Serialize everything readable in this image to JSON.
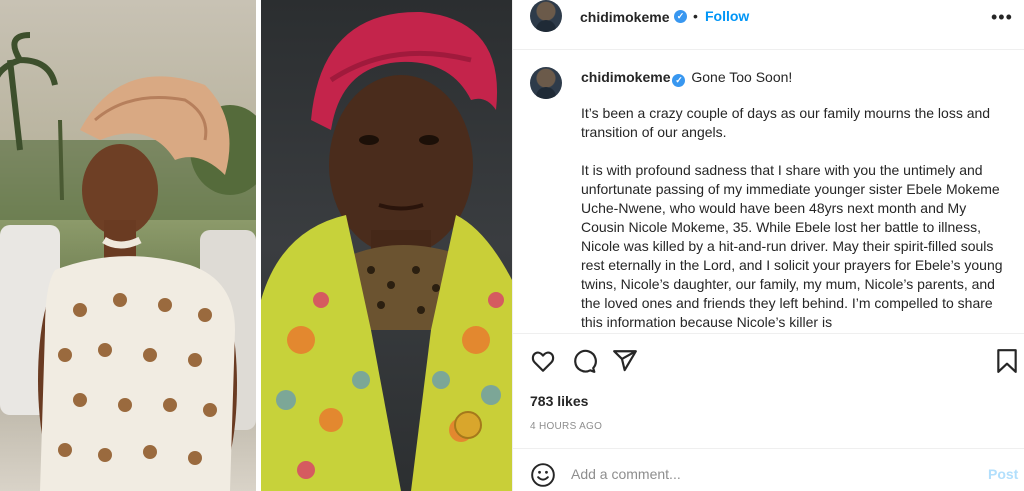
{
  "post": {
    "username": "chidimokeme",
    "follow_label": "Follow",
    "separator": "•",
    "more_icon": "more-horizontal-icon"
  },
  "caption": {
    "username": "chidimokeme",
    "title": "Gone Too Soon!",
    "paragraphs": [
      "It’s been a crazy couple of days as our family mourns the loss and transition of our angels.",
      "It is with profound sadness that I share with you the untimely and unfortunate passing of my immediate younger sister Ebele Mokeme Uche-Nwene, who would have been 48yrs next month and My Cousin Nicole Mokeme, 35. While Ebele lost her battle to illness, Nicole was killed by a hit-and-run driver. May their spirit-filled souls rest eternally in the Lord, and I solicit your prayers for Ebele’s young twins, Nicole’s daughter, our family, my mum, Nicole’s parents, and the loved ones and friends they left behind. I’m compelled to share this information because Nicole’s killer is"
    ]
  },
  "actions": {
    "like_icon": "heart-icon",
    "comment_icon": "comment-icon",
    "share_icon": "share-icon",
    "save_icon": "bookmark-icon",
    "likes": "783 likes",
    "time": "4 HOURS AGO"
  },
  "comment": {
    "placeholder": "Add a comment...",
    "post_label": "Post",
    "emoji_icon": "emoji-icon"
  },
  "colors": {
    "accent": "#0095f6",
    "verified": "#3897f0",
    "post_disabled": "#b2dffc"
  }
}
